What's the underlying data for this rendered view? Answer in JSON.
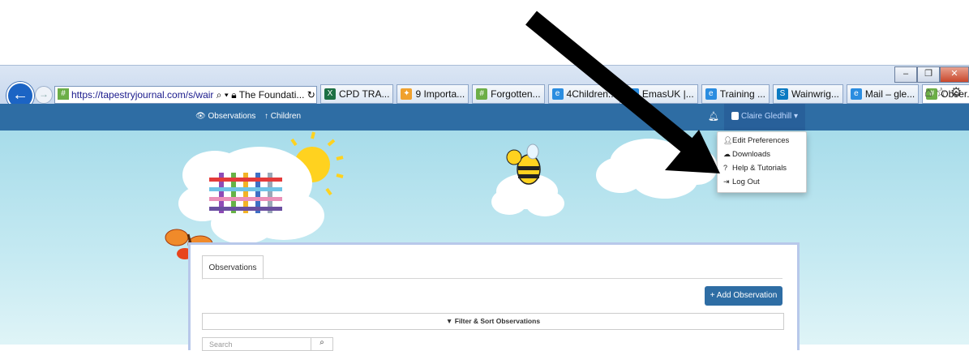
{
  "browser": {
    "url": "https://tapestryjournal.com/s/wair",
    "site_tab_title": "The Foundati...",
    "tabs": [
      {
        "label": "CPD TRA...",
        "icon": "excel-icon",
        "color": "#1d7044"
      },
      {
        "label": "9 Importa...",
        "icon": "star-icon",
        "color": "#f0a12e"
      },
      {
        "label": "Forgotten...",
        "icon": "tapestry-icon",
        "color": "#6cae47"
      },
      {
        "label": "4Children...",
        "icon": "ie-icon",
        "color": "#2b8de0"
      },
      {
        "label": "EmasUK |...",
        "icon": "ie-icon",
        "color": "#2b8de0"
      },
      {
        "label": "Training ...",
        "icon": "ie-icon",
        "color": "#2b8de0"
      },
      {
        "label": "Wainwrig...",
        "icon": "sharepoint-icon",
        "color": "#0b7ac2"
      },
      {
        "label": "Mail – gle...",
        "icon": "ie-icon",
        "color": "#2b8de0"
      },
      {
        "label": "Obser...",
        "icon": "tapestry-icon",
        "color": "#6cae47"
      }
    ]
  },
  "app": {
    "nav": {
      "observations": "Observations",
      "children": "Children"
    },
    "user_name": "Claire Gledhill",
    "dropdown": {
      "edit_preferences": "Edit Preferences",
      "downloads": "Downloads",
      "help": "Help & Tutorials",
      "logout": "Log Out"
    },
    "observations_tab": "Observations",
    "add_observation": "+ Add Observation",
    "filter_sort": "Filter & Sort Observations",
    "search_placeholder": "Search"
  },
  "colors": {
    "primary": "#2e6da4",
    "sky": "#a7dcea",
    "arrow": "#000000"
  }
}
